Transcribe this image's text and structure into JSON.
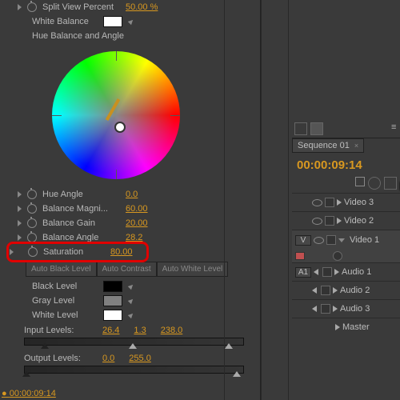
{
  "effects": {
    "split_view": {
      "label": "Split View Percent",
      "value": "50.00 %"
    },
    "white_balance": {
      "label": "White Balance"
    },
    "hue_balance_angle": {
      "label": "Hue Balance and Angle"
    },
    "hue_angle": {
      "label": "Hue Angle",
      "value": "0.0"
    },
    "balance_magni": {
      "label": "Balance Magni...",
      "value": "60.00"
    },
    "balance_gain": {
      "label": "Balance Gain",
      "value": "20.00"
    },
    "balance_angle": {
      "label": "Balance Angle",
      "value": "28.2"
    },
    "saturation": {
      "label": "Saturation",
      "value": "80.00"
    },
    "buttons": {
      "auto_black": "Auto Black Level",
      "auto_contrast": "Auto Contrast",
      "auto_white": "Auto White Level"
    },
    "black_level": {
      "label": "Black Level"
    },
    "gray_level": {
      "label": "Gray Level"
    },
    "white_level": {
      "label": "White Level"
    },
    "input_levels": {
      "label": "Input Levels:",
      "v1": "26.4",
      "v2": "1.3",
      "v3": "238.0"
    },
    "output_levels": {
      "label": "Output Levels:",
      "v1": "0.0",
      "v2": "255.0"
    },
    "timecode_bottom": "00:00:09:14"
  },
  "sequence": {
    "tab": "Sequence 01",
    "timecode": "00:00:09:14",
    "tracks": {
      "v3": "Video 3",
      "v2": "Video 2",
      "v1": "Video 1",
      "v1_head": "V",
      "a1_head": "A1",
      "a1": "Audio 1",
      "a2": "Audio 2",
      "a3": "Audio 3",
      "master": "Master"
    }
  }
}
